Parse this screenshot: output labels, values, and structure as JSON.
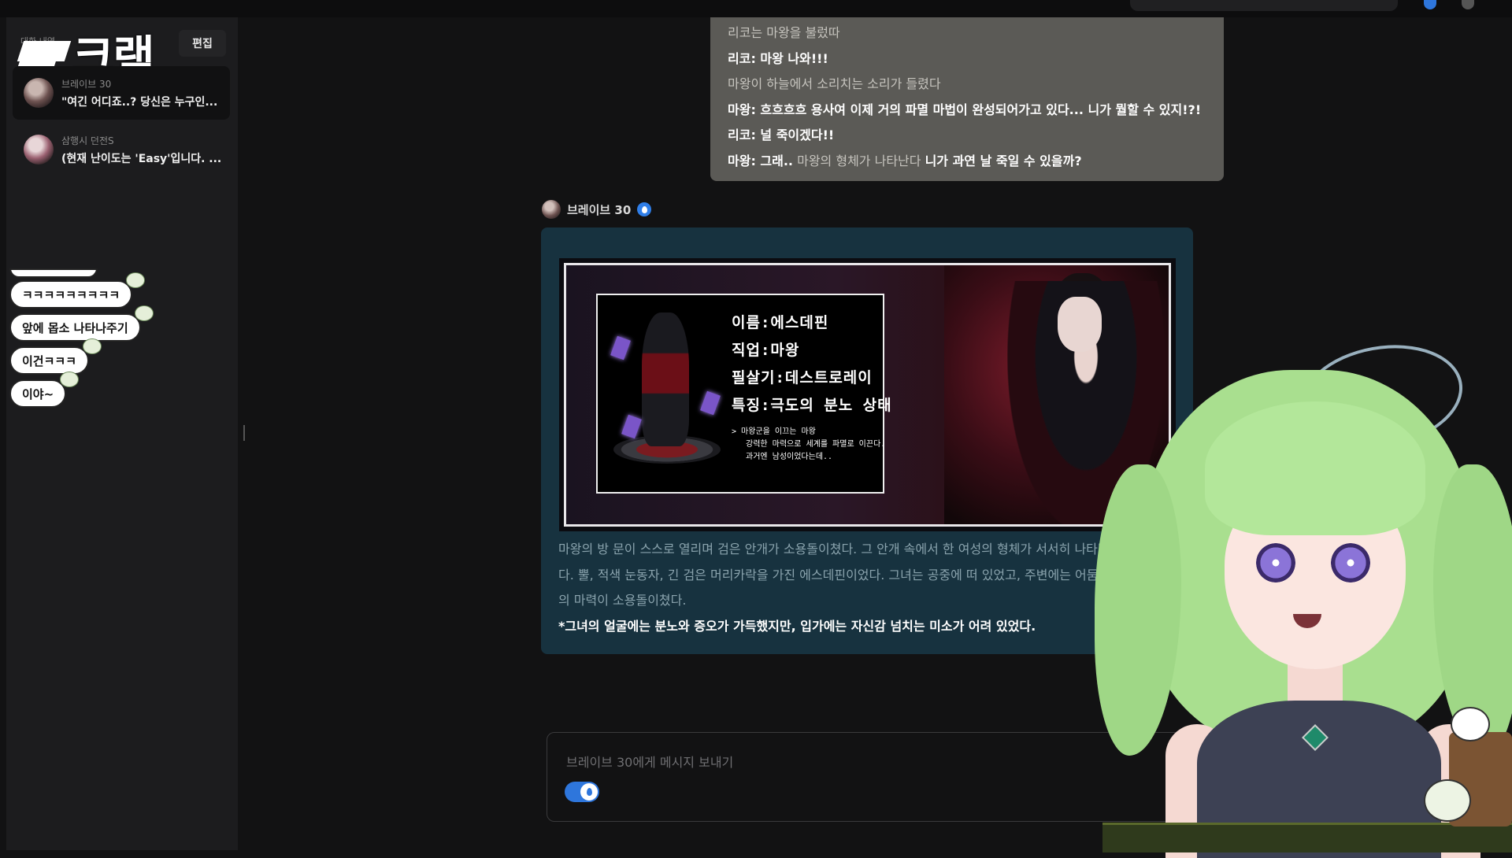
{
  "sidebar": {
    "header_label": "대화 내역",
    "edit_label": "편집",
    "logo_text": "크랙",
    "chats": [
      {
        "name": "브레이브 30",
        "preview": "\"여긴 어디죠..? 당신은 누구인...",
        "active": true
      },
      {
        "name": "삼행시 던전S",
        "preview": "(현재 난이도는 'Easy'입니다. ...",
        "active": false
      }
    ]
  },
  "comments": [
    "ㅋㅋㅋㅋㅋㅋㅋㅋㅋ",
    "앞에 몹소 나타나주기",
    "이건ㅋㅋㅋ",
    "이야~"
  ],
  "user_message": {
    "line1": "리코는 마왕을 불렀따",
    "line2": "리코: 마왕 나와!!!",
    "line3": "마왕이 하늘에서 소리치는 소리가 들렸다",
    "line4": "마왕: 흐흐흐흐 용사여 이제 거의 파멸 마법이 완성되어가고 있다... 니가 뭘할 수 있지!?!",
    "line5": "리코: 널 죽이겠다!!",
    "line6_a": "마왕: 그래..",
    "line6_b": " 마왕의 형체가 나타난다 ",
    "line6_c": "니가 과연 날 죽일 수 있을까?"
  },
  "bot": {
    "name": "브레이브 30",
    "verified_icon": "verified-badge-icon",
    "card": {
      "name_line": "이름:에스데핀",
      "job_line": "직업:마왕",
      "skill_line": "필살기:데스트로레이",
      "trait_line": "특징:극도의 분노 상태",
      "desc1": "> 마왕군을 이끄는 마왕",
      "desc2": "강력한 마력으로 세계를 파멸로 이끈다.",
      "desc3": "과거엔 남성이었다는데.."
    },
    "para1": "마왕의 방 문이 스스로 열리며 검은 안개가 소용돌이쳤다. 그 안개 속에서 한 여성의 형체가 서서히 나타났다. 뿔, 적색 눈동자, 긴 검은 머리카락을 가진 에스데핀이었다. 그녀는 공중에 떠 있었고, 주변에는 어둠의 마력이 소용돌이쳤다.",
    "para2": "*그녀의 얼굴에는 분노와 증오가 가득했지만, 입가에는 자신감 넘치는 미소가 어려 있었다."
  },
  "input": {
    "placeholder": "브레이브 30에게 메시지 보내기",
    "toggle_on": true
  },
  "colors": {
    "accent": "#2e76dc",
    "bot_bubble": "#17323f",
    "user_bubble": "#5b5a56"
  }
}
